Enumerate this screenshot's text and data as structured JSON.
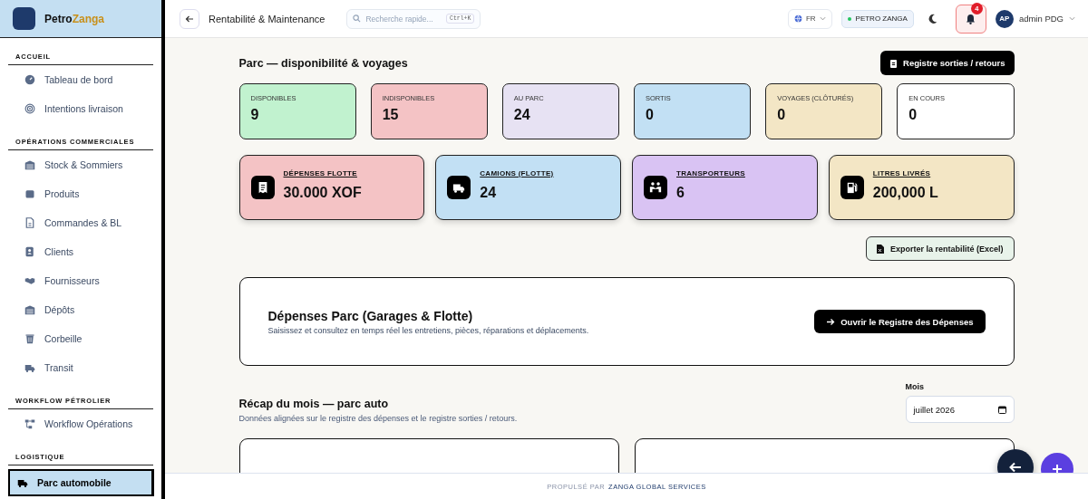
{
  "sidebar": {
    "brand": {
      "first": "Petro",
      "second": "Zanga"
    },
    "sections": [
      {
        "label": "ACCUEIL",
        "items": [
          {
            "label": "Tableau de bord",
            "kind": "gauge",
            "selected": false
          },
          {
            "label": "Intentions livraison",
            "kind": "target",
            "selected": false
          }
        ]
      },
      {
        "label": "OPÉRATIONS COMMERCIALES",
        "items": [
          {
            "label": "Stock & Sommiers",
            "kind": "warehouse",
            "selected": false
          },
          {
            "label": "Produits",
            "kind": "box",
            "selected": false
          },
          {
            "label": "Commandes & BL",
            "kind": "file",
            "selected": false
          },
          {
            "label": "Clients",
            "kind": "contact",
            "selected": false
          },
          {
            "label": "Fournisseurs",
            "kind": "handshake",
            "selected": false
          },
          {
            "label": "Dépôts",
            "kind": "warehouse",
            "selected": false
          },
          {
            "label": "Corbeille",
            "kind": "trash",
            "selected": false
          },
          {
            "label": "Transit",
            "kind": "truck",
            "selected": false
          }
        ]
      },
      {
        "label": "WORKFLOW PÉTROLIER",
        "items": [
          {
            "label": "Workflow Opérations",
            "kind": "flow",
            "selected": false
          }
        ]
      },
      {
        "label": "LOGISTIQUE",
        "items": [
          {
            "label": "Parc automobile",
            "kind": "truck",
            "selected": true
          }
        ]
      }
    ]
  },
  "topbar": {
    "title": "Rentabilité & Maintenance",
    "search": {
      "placeholder": "Recherche rapide...",
      "shortcut": "Ctrl+K"
    },
    "language": "FR",
    "company": "PETRO ZANGA",
    "notifications": "4",
    "user": {
      "initials": "AP",
      "name": "admin PDG"
    }
  },
  "fleet": {
    "title": "Parc — disponibilité & voyages",
    "register_button": "Registre sorties / retours",
    "stats": [
      {
        "label": "DISPONIBLES",
        "value": "9",
        "color": "#c1f2cf"
      },
      {
        "label": "INDISPONIBLES",
        "value": "15",
        "color": "#f4c3c5"
      },
      {
        "label": "AU PARC",
        "value": "24",
        "color": "#e7e2f3"
      },
      {
        "label": "SORTIS",
        "value": "0",
        "color": "#c2e0f4"
      },
      {
        "label": "VOYAGES (CLÔTURÉS)",
        "value": "0",
        "color": "#f3e6c5"
      },
      {
        "label": "EN COURS",
        "value": "0",
        "color": "#ffffff"
      }
    ],
    "kpis": [
      {
        "label": "DÉPENSES FLOTTE",
        "value": "30.000 XOF",
        "color": "#f4c3c5",
        "kind": "receipt"
      },
      {
        "label": "CAMIONS (FLOTTE)",
        "value": "24",
        "color": "#c2e0f4",
        "kind": "truck"
      },
      {
        "label": "TRANSPORTEURS",
        "value": "6",
        "color": "#d9c3f3",
        "kind": "people"
      },
      {
        "label": "LITRES LIVRÉS",
        "value": "200,000 L",
        "color": "#f3e6c5",
        "kind": "fuel"
      }
    ],
    "export_button": "Exporter la rentabilité (Excel)"
  },
  "expenses": {
    "title": "Dépenses Parc (Garages & Flotte)",
    "description": "Saisissez et consultez en temps réel les entretiens, pièces, réparations et déplacements.",
    "button": "Ouvrir le Registre des Dépenses"
  },
  "recap": {
    "title": "Récap du mois — parc auto",
    "subtitle": "Données alignées sur le registre des dépenses et le registre sorties / retours.",
    "month": {
      "label": "Mois",
      "value": "juillet 2026"
    }
  },
  "footer": {
    "prefix": "PROPULSÉ PAR",
    "brand": "ZANGA GLOBAL SERVICES"
  }
}
